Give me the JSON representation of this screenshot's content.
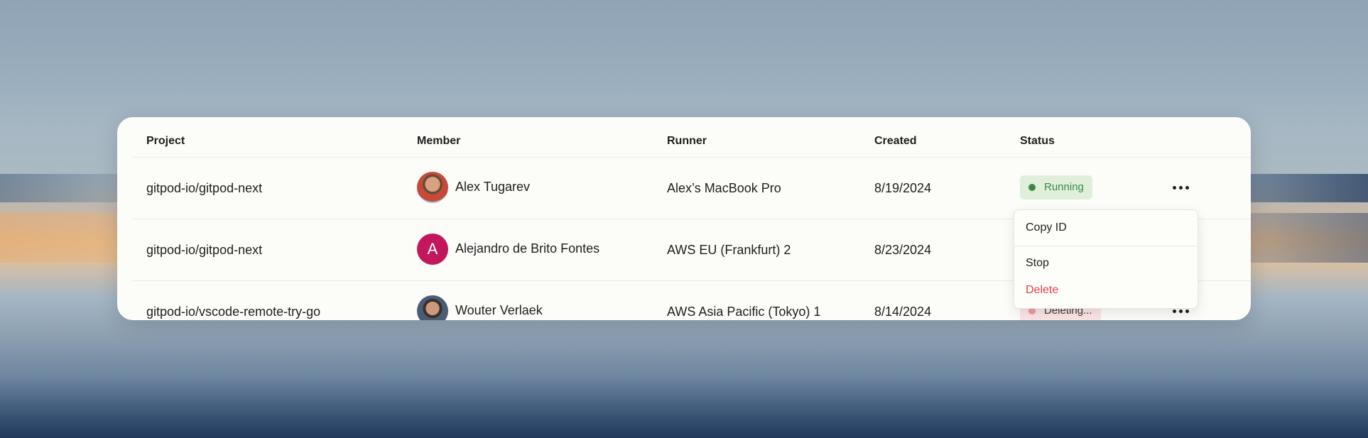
{
  "table": {
    "headers": {
      "project": "Project",
      "member": "Member",
      "runner": "Runner",
      "created": "Created",
      "status": "Status"
    },
    "rows": [
      {
        "project": "gitpod-io/gitpod-next",
        "member": "Alex Tugarev",
        "avatar": "photo",
        "runner": "Alex’s MacBook Pro",
        "created": "8/19/2024",
        "status": "Running"
      },
      {
        "project": "gitpod-io/gitpod-next",
        "member": "Alejandro de Brito Fontes",
        "avatar_letter": "A",
        "runner": "AWS EU (Frankfurt) 2",
        "created": "8/23/2024",
        "status": ""
      },
      {
        "project": "gitpod-io/vscode-remote-try-go",
        "member": "Wouter Verlaek",
        "avatar": "photo",
        "runner": "AWS Asia Pacific (Tokyo) 1",
        "created": "8/14/2024",
        "status": "Deleting..."
      }
    ]
  },
  "menu": {
    "copy_id": "Copy ID",
    "stop": "Stop",
    "delete": "Delete"
  },
  "colors": {
    "running": "#3a8a45",
    "deleting": "#f29a9a",
    "danger": "#e0404a",
    "avatar_letter_bg": "#c2185b"
  },
  "icons": [
    "more-options-icon",
    "status-dot-icon"
  ]
}
